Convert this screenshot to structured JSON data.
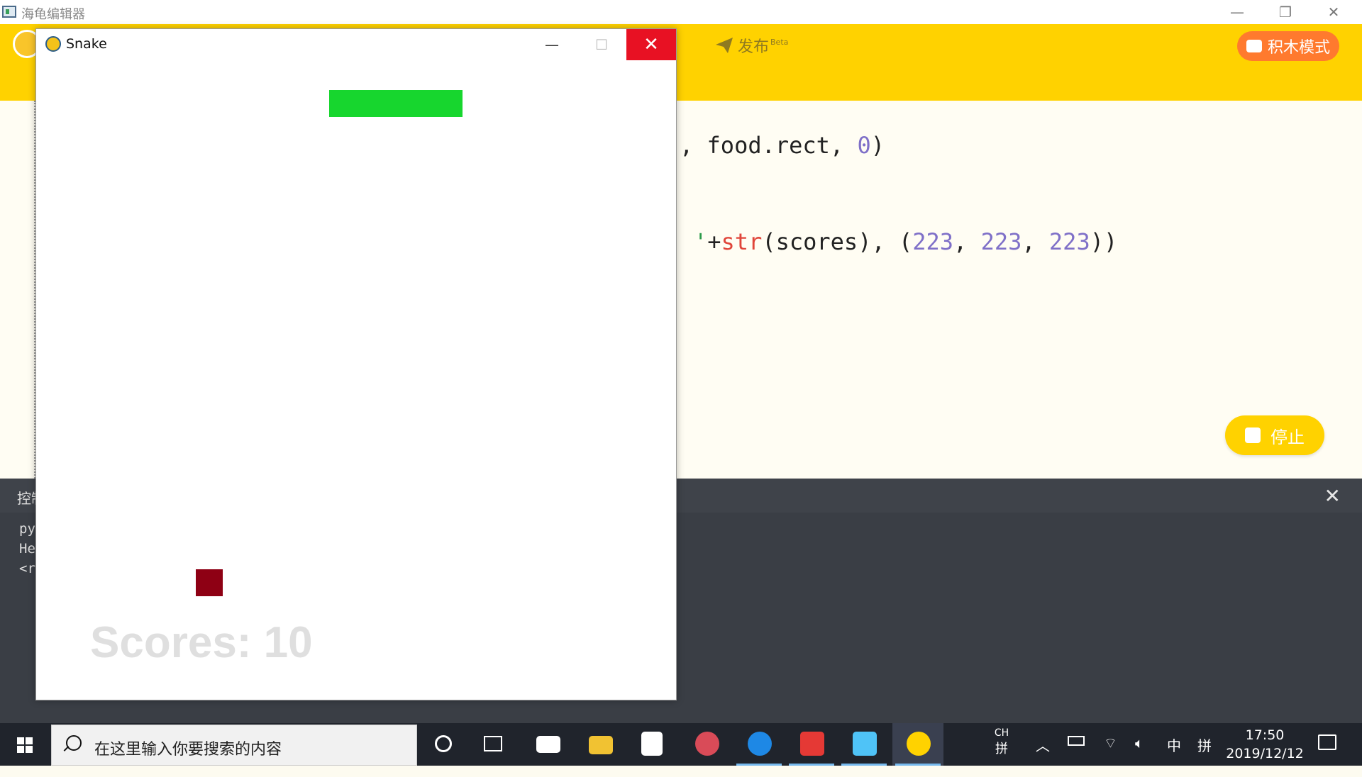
{
  "editor": {
    "title": "海龟编辑器",
    "publish_label": "发布",
    "publish_beta": "Beta",
    "block_mode_label": "积木模式",
    "stop_label": "停止",
    "code_lines": [
      {
        "segments": [
          ", food.rect, ",
          "0",
          ")"
        ]
      },
      {
        "segments": [
          "'",
          "+",
          "str",
          "(scores), (",
          "223",
          ", ",
          "223",
          ", ",
          "223",
          "))"
        ]
      }
    ]
  },
  "console": {
    "label": "控制台",
    "lines": [
      "py",
      "He",
      "<r"
    ]
  },
  "snake_window": {
    "title": "Snake",
    "scores_text": "Scores: 10",
    "colors": {
      "snake": "#17d62e",
      "food": "#8e0014",
      "score_text": "#dfdfdf"
    }
  },
  "taskbar": {
    "search_placeholder": "在这里输入你要搜索的内容",
    "input_lang": "CH",
    "ime_mode": "拼",
    "lang_indicator": "中",
    "time": "17:50",
    "date": "2019/12/12",
    "apps": [
      "cortana-icon",
      "task-view-icon",
      "mail-icon",
      "file-explorer-icon",
      "store-icon",
      "satellite-app-icon",
      "edge-icon",
      "game-app-icon",
      "bird-app-icon",
      "python-turtle-icon"
    ]
  }
}
